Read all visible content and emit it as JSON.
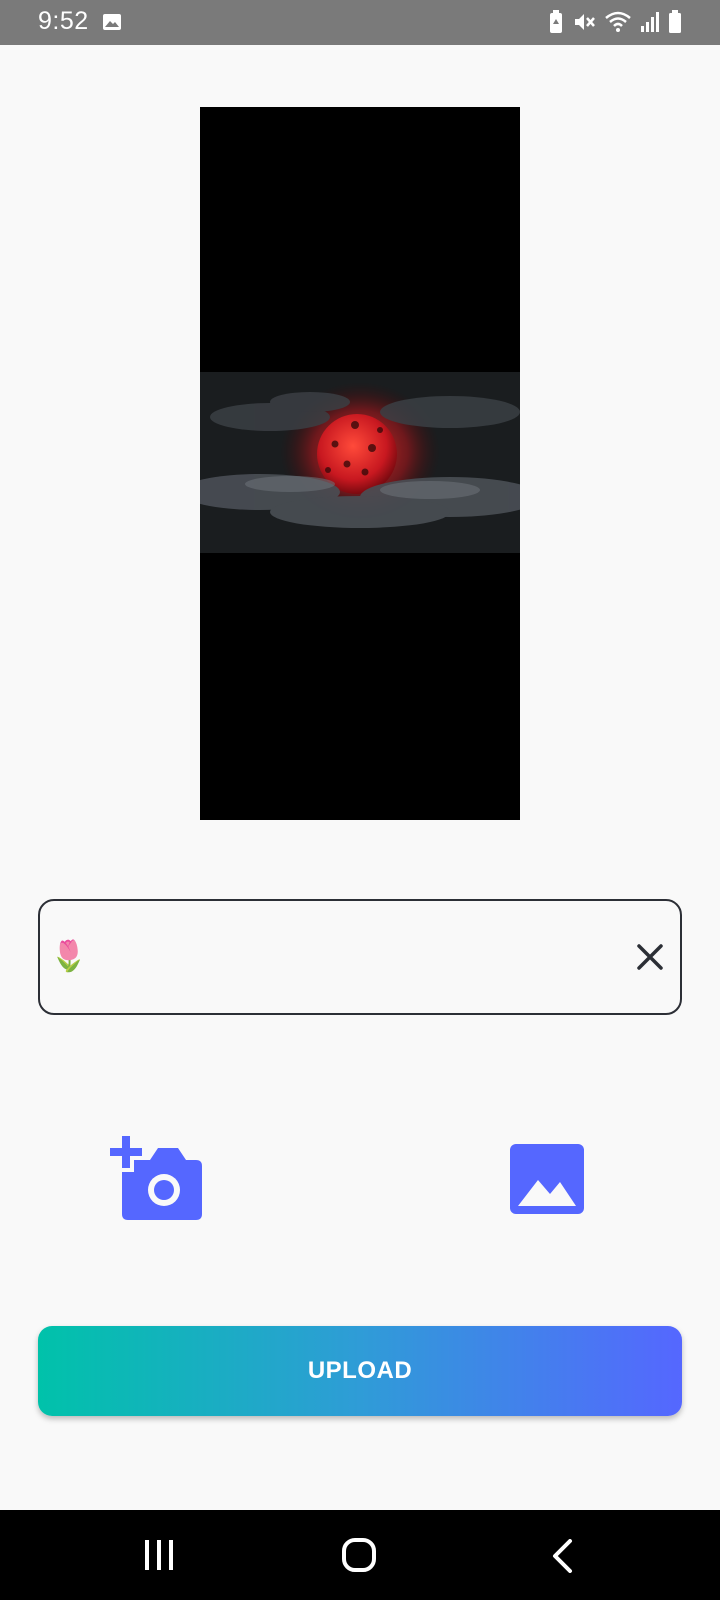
{
  "status_bar": {
    "time": "9:52",
    "icons": [
      "image-icon",
      "battery-saver-icon",
      "mute-icon",
      "wifi-icon",
      "signal-icon",
      "battery-icon"
    ]
  },
  "preview": {
    "image_icon": "red-moon-clouds-image"
  },
  "caption_input": {
    "value": "🌷",
    "clear_icon": "close-icon"
  },
  "actions": {
    "camera_icon": "add-a-photo-icon",
    "gallery_icon": "image-gallery-icon"
  },
  "upload_button": {
    "label": "UPLOAD",
    "gradient": [
      "#00c2aa",
      "#5567ff"
    ]
  },
  "colors": {
    "accent": "#5567ff",
    "status_bar": "#7a7a7a",
    "nav_bar": "#000000"
  },
  "nav_bar": {
    "icons": [
      "recents-icon",
      "home-icon",
      "back-icon"
    ]
  }
}
